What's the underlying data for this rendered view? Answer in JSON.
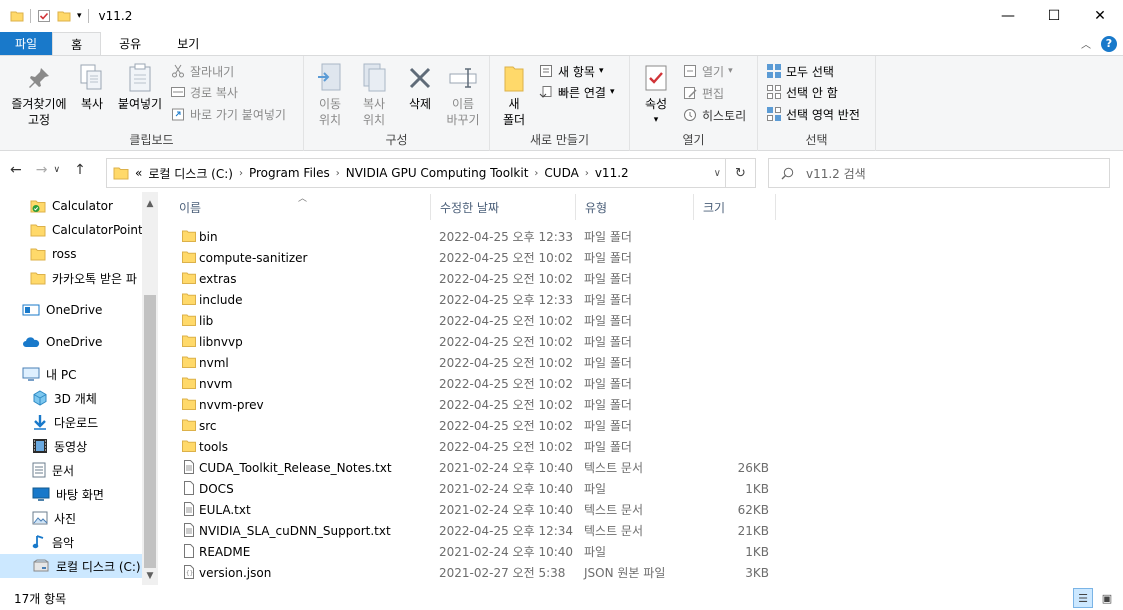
{
  "window": {
    "title": "v11.2",
    "minimize": "—",
    "maximize": "☐",
    "close": "✕"
  },
  "ribbon_tabs": [
    "파일",
    "홈",
    "공유",
    "보기"
  ],
  "ribbon": {
    "clipboard": {
      "label": "클립보드",
      "pin": "즐겨찾기에\n고정",
      "copy": "복사",
      "paste": "붙여넣기",
      "cut": "잘라내기",
      "copy_path": "경로 복사",
      "paste_shortcut": "바로 가기 붙여넣기"
    },
    "organize": {
      "label": "구성",
      "move": "이동\n위치",
      "copy_to": "복사\n위치",
      "delete": "삭제",
      "rename": "이름\n바꾸기"
    },
    "new": {
      "label": "새로 만들기",
      "new_folder": "새\n폴더",
      "new_item": "새 항목",
      "easy_access": "빠른 연결"
    },
    "open": {
      "label": "열기",
      "properties": "속성",
      "open": "열기",
      "edit": "편집",
      "history": "히스토리"
    },
    "select": {
      "label": "선택",
      "select_all": "모두 선택",
      "select_none": "선택 안 함",
      "invert": "선택 영역 반전"
    }
  },
  "address": {
    "overflow": "«",
    "crumbs": [
      "로컬 디스크 (C:)",
      "Program Files",
      "NVIDIA GPU Computing Toolkit",
      "CUDA",
      "v11.2"
    ]
  },
  "search": {
    "placeholder": "v11.2 검색"
  },
  "nav_pane": [
    {
      "label": "Calculator",
      "icon": "folder-check-icon",
      "selected": false
    },
    {
      "label": "CalculatorPointe",
      "icon": "folder-icon",
      "selected": false
    },
    {
      "label": "ross",
      "icon": "folder-icon",
      "selected": false
    },
    {
      "label": "카카오톡 받은 파",
      "icon": "folder-icon",
      "selected": false
    },
    {
      "label": "OneDrive",
      "icon": "onedrive-business-icon",
      "selected": false
    },
    {
      "label": "OneDrive",
      "icon": "onedrive-cloud-icon",
      "selected": false
    },
    {
      "label": "내 PC",
      "icon": "pc-icon",
      "selected": false
    },
    {
      "label": "3D 개체",
      "icon": "3d-objects-icon",
      "selected": false
    },
    {
      "label": "다운로드",
      "icon": "download-icon",
      "selected": false
    },
    {
      "label": "동영상",
      "icon": "video-icon",
      "selected": false
    },
    {
      "label": "문서",
      "icon": "documents-icon",
      "selected": false
    },
    {
      "label": "바탕 화면",
      "icon": "desktop-icon",
      "selected": false
    },
    {
      "label": "사진",
      "icon": "pictures-icon",
      "selected": false
    },
    {
      "label": "음악",
      "icon": "music-icon",
      "selected": false
    },
    {
      "label": "로컬 디스크 (C:)",
      "icon": "drive-icon",
      "selected": true
    }
  ],
  "columns": [
    "이름",
    "수정한 날짜",
    "유형",
    "크기"
  ],
  "files": [
    {
      "name": "bin",
      "date": "2022-04-25 오후 12:33",
      "type": "파일 폴더",
      "size": "",
      "kind": "folder"
    },
    {
      "name": "compute-sanitizer",
      "date": "2022-04-25 오전 10:02",
      "type": "파일 폴더",
      "size": "",
      "kind": "folder"
    },
    {
      "name": "extras",
      "date": "2022-04-25 오전 10:02",
      "type": "파일 폴더",
      "size": "",
      "kind": "folder"
    },
    {
      "name": "include",
      "date": "2022-04-25 오후 12:33",
      "type": "파일 폴더",
      "size": "",
      "kind": "folder"
    },
    {
      "name": "lib",
      "date": "2022-04-25 오전 10:02",
      "type": "파일 폴더",
      "size": "",
      "kind": "folder"
    },
    {
      "name": "libnvvp",
      "date": "2022-04-25 오전 10:02",
      "type": "파일 폴더",
      "size": "",
      "kind": "folder"
    },
    {
      "name": "nvml",
      "date": "2022-04-25 오전 10:02",
      "type": "파일 폴더",
      "size": "",
      "kind": "folder"
    },
    {
      "name": "nvvm",
      "date": "2022-04-25 오전 10:02",
      "type": "파일 폴더",
      "size": "",
      "kind": "folder"
    },
    {
      "name": "nvvm-prev",
      "date": "2022-04-25 오전 10:02",
      "type": "파일 폴더",
      "size": "",
      "kind": "folder"
    },
    {
      "name": "src",
      "date": "2022-04-25 오전 10:02",
      "type": "파일 폴더",
      "size": "",
      "kind": "folder"
    },
    {
      "name": "tools",
      "date": "2022-04-25 오전 10:02",
      "type": "파일 폴더",
      "size": "",
      "kind": "folder"
    },
    {
      "name": "CUDA_Toolkit_Release_Notes.txt",
      "date": "2021-02-24 오후 10:40",
      "type": "텍스트 문서",
      "size": "26KB",
      "kind": "text"
    },
    {
      "name": "DOCS",
      "date": "2021-02-24 오후 10:40",
      "type": "파일",
      "size": "1KB",
      "kind": "file"
    },
    {
      "name": "EULA.txt",
      "date": "2021-02-24 오후 10:40",
      "type": "텍스트 문서",
      "size": "62KB",
      "kind": "text"
    },
    {
      "name": "NVIDIA_SLA_cuDNN_Support.txt",
      "date": "2022-04-25 오후 12:34",
      "type": "텍스트 문서",
      "size": "21KB",
      "kind": "text"
    },
    {
      "name": "README",
      "date": "2021-02-24 오후 10:40",
      "type": "파일",
      "size": "1KB",
      "kind": "file"
    },
    {
      "name": "version.json",
      "date": "2021-02-27 오전 5:38",
      "type": "JSON 원본 파일",
      "size": "3KB",
      "kind": "json"
    }
  ],
  "status": {
    "count": "17개 항목"
  },
  "colors": {
    "accent": "#1979ca",
    "folder": "#ffd96a",
    "selected": "#cce8ff"
  }
}
